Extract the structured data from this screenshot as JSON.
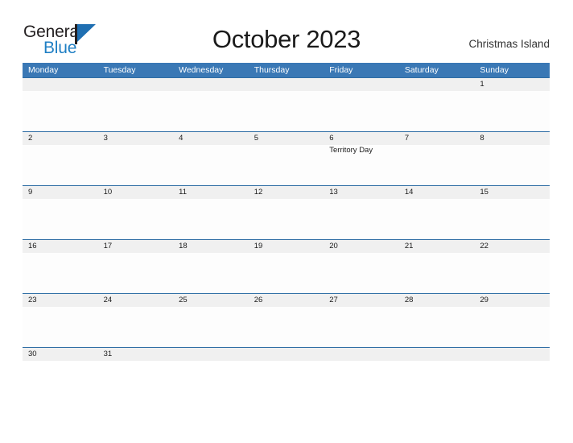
{
  "logo": {
    "text_primary": "General",
    "text_secondary": "Blue",
    "mark_icon": "flag-triangle-icon",
    "color_primary": "#231f20",
    "color_secondary": "#1f7fc4",
    "color_mark": "#1f6fb2"
  },
  "header": {
    "title": "October 2023",
    "location": "Christmas Island"
  },
  "theme": {
    "header_blue": "#3a78b5",
    "rule_blue": "#2e6da4",
    "number_band_gray": "#f0f0f0",
    "body_white": "#ffffff"
  },
  "calendar": {
    "weekdays": [
      {
        "label": "Monday"
      },
      {
        "label": "Tuesday"
      },
      {
        "label": "Wednesday"
      },
      {
        "label": "Thursday"
      },
      {
        "label": "Friday"
      },
      {
        "label": "Saturday"
      },
      {
        "label": "Sunday"
      }
    ],
    "weeks": [
      {
        "days": [
          {
            "num": "",
            "event": ""
          },
          {
            "num": "",
            "event": ""
          },
          {
            "num": "",
            "event": ""
          },
          {
            "num": "",
            "event": ""
          },
          {
            "num": "",
            "event": ""
          },
          {
            "num": "",
            "event": ""
          },
          {
            "num": "1",
            "event": ""
          }
        ]
      },
      {
        "days": [
          {
            "num": "2",
            "event": ""
          },
          {
            "num": "3",
            "event": ""
          },
          {
            "num": "4",
            "event": ""
          },
          {
            "num": "5",
            "event": ""
          },
          {
            "num": "6",
            "event": "Territory Day"
          },
          {
            "num": "7",
            "event": ""
          },
          {
            "num": "8",
            "event": ""
          }
        ]
      },
      {
        "days": [
          {
            "num": "9",
            "event": ""
          },
          {
            "num": "10",
            "event": ""
          },
          {
            "num": "11",
            "event": ""
          },
          {
            "num": "12",
            "event": ""
          },
          {
            "num": "13",
            "event": ""
          },
          {
            "num": "14",
            "event": ""
          },
          {
            "num": "15",
            "event": ""
          }
        ]
      },
      {
        "days": [
          {
            "num": "16",
            "event": ""
          },
          {
            "num": "17",
            "event": ""
          },
          {
            "num": "18",
            "event": ""
          },
          {
            "num": "19",
            "event": ""
          },
          {
            "num": "20",
            "event": ""
          },
          {
            "num": "21",
            "event": ""
          },
          {
            "num": "22",
            "event": ""
          }
        ]
      },
      {
        "days": [
          {
            "num": "23",
            "event": ""
          },
          {
            "num": "24",
            "event": ""
          },
          {
            "num": "25",
            "event": ""
          },
          {
            "num": "26",
            "event": ""
          },
          {
            "num": "27",
            "event": ""
          },
          {
            "num": "28",
            "event": ""
          },
          {
            "num": "29",
            "event": ""
          }
        ]
      },
      {
        "days": [
          {
            "num": "30",
            "event": ""
          },
          {
            "num": "31",
            "event": ""
          },
          {
            "num": "",
            "event": ""
          },
          {
            "num": "",
            "event": ""
          },
          {
            "num": "",
            "event": ""
          },
          {
            "num": "",
            "event": ""
          },
          {
            "num": "",
            "event": ""
          }
        ]
      }
    ]
  }
}
